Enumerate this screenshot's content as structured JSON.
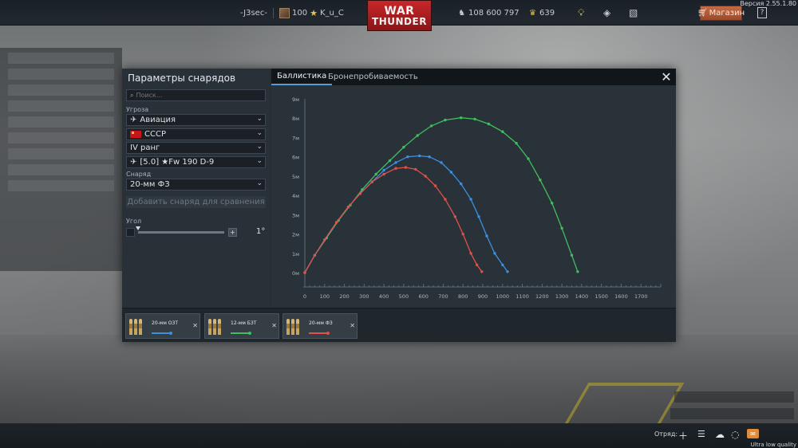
{
  "topbar": {
    "player_left": "-J3sec-",
    "rank_value": "100",
    "player_name": "K_u_C",
    "logo_line1": "WAR",
    "logo_line2": "THUNDER",
    "silver_lions": "108 600 797",
    "golden_eagles": "639",
    "shop_label": "Магазин",
    "help_label": "?",
    "version": "Версия 2.55.1.80"
  },
  "params_panel": {
    "title": "Параметры снарядов",
    "search_placeholder": "Поиск...",
    "threat_label": "Угроза",
    "threat_value": "Авиация",
    "country_value": "СССР",
    "rank_value": "IV ранг",
    "vehicle_value": "[5.0] ★Fw 190 D-9",
    "shell_label": "Снаряд",
    "shell_value": "20-мм ФЗ",
    "add_button": "Добавить снаряд для сравнения",
    "angle_label": "Угол",
    "angle_value": "1°",
    "plus_label": "+"
  },
  "tabs": [
    {
      "label": "Баллистика",
      "active": true
    },
    {
      "label": "Бронепробиваемость",
      "active": false
    }
  ],
  "close_label": "✕",
  "chart_data": {
    "type": "line",
    "title": "",
    "xlabel": "",
    "ylabel": "",
    "xlim": [
      0,
      1800
    ],
    "ylim": [
      0,
      9
    ],
    "x_ticks": [
      0,
      100,
      200,
      300,
      400,
      500,
      600,
      700,
      800,
      900,
      1000,
      1100,
      1200,
      1300,
      1400,
      1500,
      1600,
      1700
    ],
    "y_ticks": [
      "0м",
      "1м",
      "2м",
      "3м",
      "4м",
      "5м",
      "6м",
      "7м",
      "8м",
      "9м"
    ],
    "series": [
      {
        "color": "#3fbf5f",
        "points": [
          [
            0,
            0
          ],
          [
            50,
            0.9
          ],
          [
            110,
            1.8
          ],
          [
            170,
            2.7
          ],
          [
            230,
            3.5
          ],
          [
            290,
            4.3
          ],
          [
            360,
            5.1
          ],
          [
            430,
            5.8
          ],
          [
            500,
            6.5
          ],
          [
            570,
            7.1
          ],
          [
            640,
            7.6
          ],
          [
            710,
            7.9
          ],
          [
            790,
            8.02
          ],
          [
            860,
            7.95
          ],
          [
            930,
            7.7
          ],
          [
            1000,
            7.3
          ],
          [
            1070,
            6.7
          ],
          [
            1130,
            5.9
          ],
          [
            1190,
            4.8
          ],
          [
            1250,
            3.6
          ],
          [
            1300,
            2.3
          ],
          [
            1350,
            0.9
          ],
          [
            1380,
            0.05
          ]
        ]
      },
      {
        "color": "#3d8fe0",
        "points": [
          [
            0,
            0
          ],
          [
            50,
            0.9
          ],
          [
            100,
            1.7
          ],
          [
            160,
            2.6
          ],
          [
            220,
            3.4
          ],
          [
            280,
            4.1
          ],
          [
            340,
            4.7
          ],
          [
            400,
            5.3
          ],
          [
            460,
            5.7
          ],
          [
            520,
            6.0
          ],
          [
            580,
            6.05
          ],
          [
            630,
            6.0
          ],
          [
            690,
            5.7
          ],
          [
            740,
            5.2
          ],
          [
            790,
            4.6
          ],
          [
            840,
            3.8
          ],
          [
            880,
            2.9
          ],
          [
            920,
            1.9
          ],
          [
            960,
            1.0
          ],
          [
            1000,
            0.4
          ],
          [
            1025,
            0.05
          ]
        ]
      },
      {
        "color": "#e0514a",
        "points": [
          [
            0,
            0
          ],
          [
            50,
            0.9
          ],
          [
            100,
            1.7
          ],
          [
            160,
            2.6
          ],
          [
            220,
            3.4
          ],
          [
            280,
            4.1
          ],
          [
            340,
            4.7
          ],
          [
            400,
            5.1
          ],
          [
            460,
            5.4
          ],
          [
            510,
            5.45
          ],
          [
            560,
            5.35
          ],
          [
            610,
            5.0
          ],
          [
            660,
            4.5
          ],
          [
            710,
            3.8
          ],
          [
            760,
            2.9
          ],
          [
            800,
            2.0
          ],
          [
            840,
            1.0
          ],
          [
            870,
            0.4
          ],
          [
            895,
            0.05
          ]
        ]
      }
    ]
  },
  "ammo_cards": [
    {
      "name": "20-мм ОЗТ",
      "color": "#3d8fe0"
    },
    {
      "name": "12-мм БЗТ",
      "color": "#3fbf5f"
    },
    {
      "name": "20-мм ФЗ",
      "color": "#e0514a"
    }
  ],
  "bottombar": {
    "squad_label": "Отряд:",
    "quality_label": "Ultra low quality"
  }
}
